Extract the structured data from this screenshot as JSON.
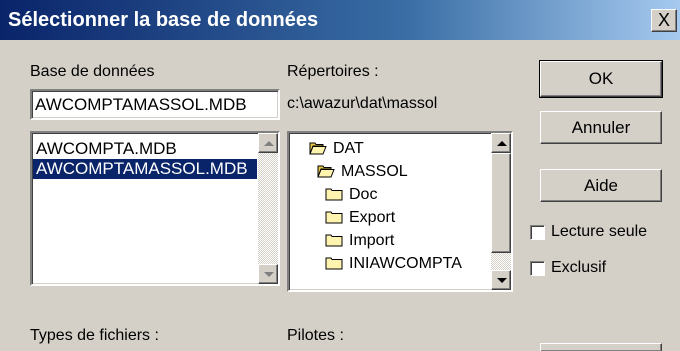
{
  "window": {
    "title": "Sélectionner la base de données",
    "close_label": "X"
  },
  "database": {
    "label": "Base de données",
    "value": "AWCOMPTAMASSOL.MDB",
    "files": [
      {
        "name": "AWCOMPTA.MDB",
        "selected": false
      },
      {
        "name": "AWCOMPTAMASSOL.MDB",
        "selected": true
      }
    ]
  },
  "directories": {
    "label": "Répertoires :",
    "current_path": "c:\\awazur\\dat\\massol",
    "items": [
      {
        "name": "DAT",
        "icon": "open-folder-icon"
      },
      {
        "name": "MASSOL",
        "icon": "open-folder-icon"
      },
      {
        "name": "Doc",
        "icon": "folder-icon"
      },
      {
        "name": "Export",
        "icon": "folder-icon"
      },
      {
        "name": "Import",
        "icon": "folder-icon"
      },
      {
        "name": "INIAWCOMPTA",
        "icon": "folder-icon"
      }
    ]
  },
  "buttons": {
    "ok": "OK",
    "cancel": "Annuler",
    "help": "Aide"
  },
  "options": {
    "read_only": {
      "label": "Lecture seule",
      "checked": false
    },
    "exclusive": {
      "label": "Exclusif",
      "checked": false
    }
  },
  "file_types": {
    "label": "Types de fichiers :"
  },
  "drivers": {
    "label": "Pilotes :"
  },
  "colors": {
    "title_bar": "#0a246a",
    "selection": "#0a246a",
    "face": "#d4d0c8"
  }
}
